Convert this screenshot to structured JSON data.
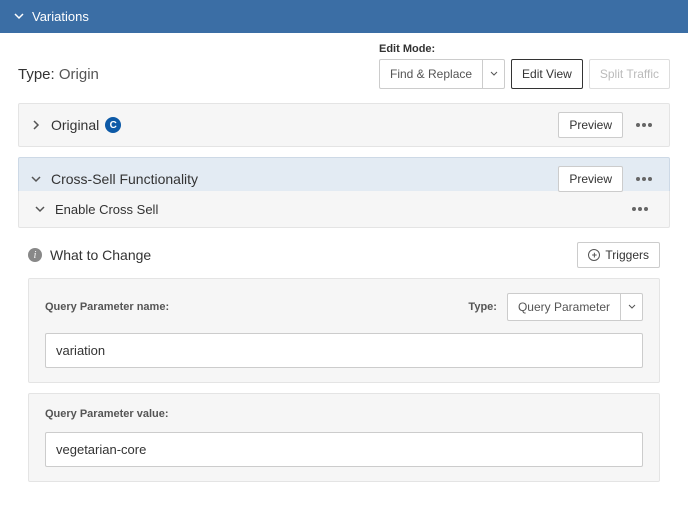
{
  "header": {
    "title": "Variations"
  },
  "type": {
    "key": "Type:",
    "value": "Origin"
  },
  "editMode": {
    "label": "Edit Mode:",
    "select": "Find & Replace",
    "editView": "Edit View",
    "splitTraffic": "Split Traffic"
  },
  "variations": {
    "original": {
      "label": "Original",
      "badge": "C",
      "preview": "Preview"
    },
    "cross": {
      "label": "Cross-Sell Functionality",
      "preview": "Preview"
    },
    "enable": {
      "label": "Enable Cross Sell"
    }
  },
  "section": {
    "title": "What to Change",
    "triggers": "Triggers"
  },
  "form": {
    "paramNameLabel": "Query Parameter name:",
    "typeLabel": "Type:",
    "typeSelect": "Query Parameter",
    "paramNameValue": "variation",
    "paramValueLabel": "Query Parameter value:",
    "paramValueValue": "vegetarian-core"
  }
}
